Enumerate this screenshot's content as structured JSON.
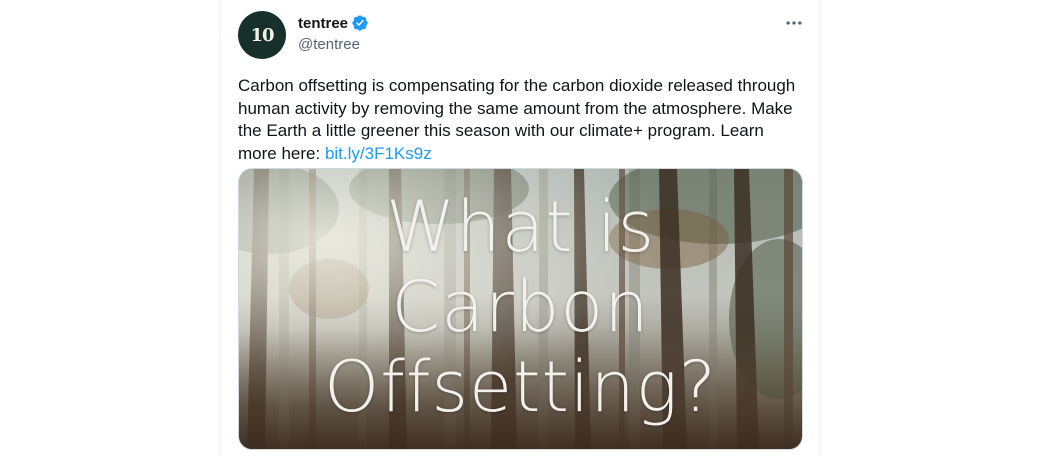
{
  "author": {
    "display_name": "tentree",
    "handle": "@tentree",
    "avatar_text": "10",
    "verified": true,
    "verified_color": "#1d9bf0",
    "avatar_color": "#17302b"
  },
  "tweet": {
    "text": "Carbon offsetting is compensating for the carbon dioxide released through human activity by removing the same amount from the atmosphere. Make the Earth a little greener this season with our climate+ program. Learn more here: ",
    "link": "bit.ly/3F1Ks9z",
    "link_color": "#1d9bf0"
  },
  "media": {
    "overlay_lines": [
      "What is",
      "Carbon",
      "Offsetting?"
    ]
  },
  "icons": {
    "verified": "verified-badge-icon",
    "more": "more-options-icon"
  }
}
